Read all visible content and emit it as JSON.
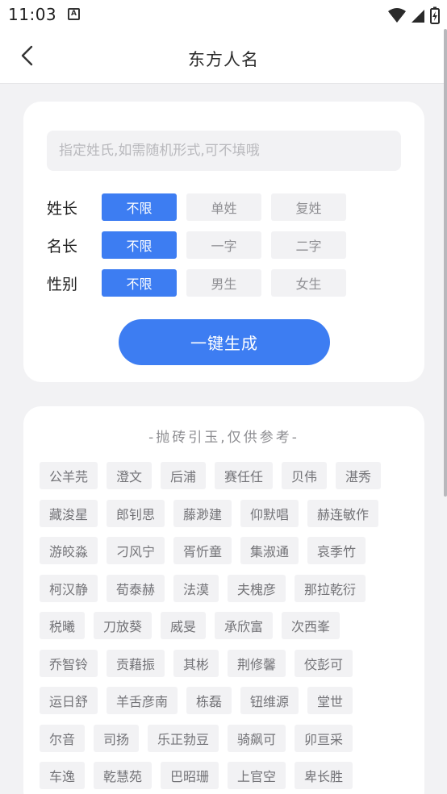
{
  "status": {
    "time": "11:03",
    "notification_icon": "A"
  },
  "header": {
    "title": "东方人名"
  },
  "form": {
    "surname_placeholder": "指定姓氏,如需随机形式,可不填哦",
    "rows": [
      {
        "label": "姓长",
        "options": [
          "不限",
          "单姓",
          "复姓"
        ],
        "selected": 0
      },
      {
        "label": "名长",
        "options": [
          "不限",
          "一字",
          "二字"
        ],
        "selected": 0
      },
      {
        "label": "性别",
        "options": [
          "不限",
          "男生",
          "女生"
        ],
        "selected": 0
      }
    ],
    "generate_label": "一键生成"
  },
  "results": {
    "caption": "-抛砖引玉,仅供参考-",
    "rows": [
      [
        "公羊芫",
        "澄文",
        "后浦",
        "赛任任",
        "贝伟",
        "湛秀"
      ],
      [
        "藏浚星",
        "郎钊思",
        "藤渺建",
        "仰默唱",
        "赫连敏作"
      ],
      [
        "游皎淼",
        "刁风宁",
        "胥忻童",
        "集淑通",
        "哀季竹"
      ],
      [
        "柯汉静",
        "荀泰赫",
        "法漠",
        "夫槐彦",
        "那拉乾衍"
      ],
      [
        "税曦",
        "刀放葵",
        "威旻",
        "承欣富",
        "次西峯"
      ],
      [
        "乔智铃",
        "贡藉振",
        "其彬",
        "荆修馨",
        "佼彭可"
      ],
      [
        "运日舒",
        "羊舌彦南",
        "栋磊",
        "钮维源",
        "堂世"
      ],
      [
        "尔音",
        "司扬",
        "乐正勃豆",
        "骑飙可",
        "卯亘采"
      ],
      [
        "车逸",
        "乾慧苑",
        "巴昭珊",
        "上官空",
        "卑长胜"
      ]
    ]
  },
  "colors": {
    "accent": "#3d7df2",
    "chip_bg": "#f2f2f4",
    "page_bg": "#f2f2f4"
  }
}
